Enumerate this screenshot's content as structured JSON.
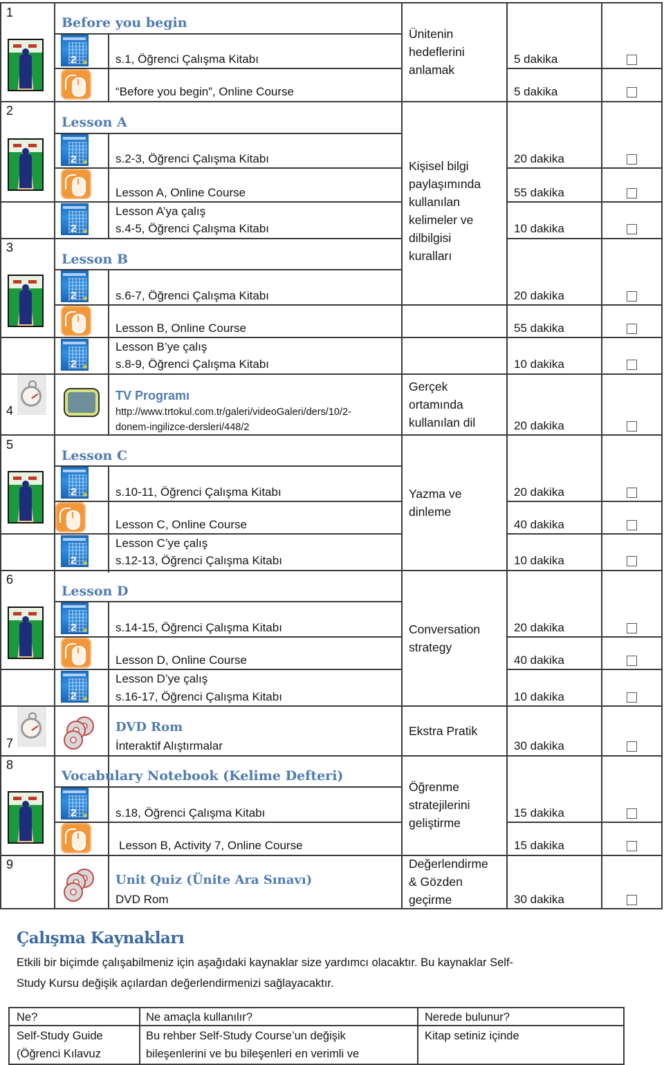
{
  "schedule": {
    "row_numbers": [
      "1",
      "2",
      "3",
      "4",
      "5",
      "6",
      "7",
      "8",
      "9"
    ],
    "section_headings": {
      "before_you_begin": "Before you begin",
      "lesson_a": "Lesson A",
      "lesson_b": "Lesson B",
      "lesson_c": "Lesson C",
      "lesson_d": "Lesson D",
      "vocabulary": "Vocabulary Notebook (Kelime Defteri)"
    },
    "items": {
      "byb_book": "s.1, Öğrenci Çalışma Kitabı",
      "byb_online": "“Before you begin”, Online Course",
      "a_book": "s.2-3, Öğrenci Çalışma Kitabı",
      "a_online": "Lesson A, Online Course",
      "a_review_1": "Lesson A’ya çalış",
      "a_review_2": "s.4-5, Öğrenci Çalışma Kitabı",
      "b_book": "s.6-7, Öğrenci Çalışma Kitabı",
      "b_online": "Lesson B, Online Course",
      "b_review_1": "Lesson B’ye çalış",
      "b_review_2": "s.8-9, Öğrenci Çalışma Kitabı",
      "tv_title": "TV Programı",
      "tv_url_1": "http://www.trtokul.com.tr/galeri/videoGaleri/ders/10/2-",
      "tv_url_2": "donem-ingilizce-dersleri/448/2",
      "c_book": "s.10-11, Öğrenci Çalışma Kitabı",
      "c_online": "Lesson C, Online Course",
      "c_review_1": "Lesson C’ye çalış",
      "c_review_2": "s.12-13, Öğrenci Çalışma Kitabı",
      "d_book": "s.14-15, Öğrenci Çalışma Kitabı",
      "d_online": "Lesson D, Online Course",
      "d_review_1": "Lesson D’ye çalış",
      "d_review_2": "s.16-17, Öğrenci Çalışma Kitabı",
      "dvd_title": "DVD Rom",
      "dvd_sub": "İnteraktif Alıştırmalar",
      "vocab_book": "s.18, Öğrenci Çalışma Kitabı",
      "vocab_online": "Lesson B, Activity 7, Online Course",
      "quiz_title": "Unit Quiz (Ünite Ara Sınavı)",
      "quiz_sub": "DVD Rom"
    },
    "goals": {
      "g1": "Ünitenin\nhedeflerini\nanlamak",
      "g2": "Kişisel bilgi\npaylaşımında\nkullanılan\nkelimeler ve\ndilbilgisi\nkuralları",
      "g3": "Gerçek\nortamında\nkullanılan dil",
      "g4": "Yazma ve\ndinleme",
      "g5": "Conversation\nstrategy",
      "g6": "Ekstra Pratik",
      "g7": "Öğrenme\nstratejilerini\ngeliştirme",
      "g8": "Değerlendirme\n& Gözden\ngeçirme"
    },
    "durations": [
      "5 dakika",
      "5 dakika",
      "20 dakika",
      "55 dakika",
      "10 dakika",
      "20 dakika",
      "55 dakika",
      "10 dakika",
      "20 dakika",
      "20 dakika",
      "40 dakika",
      "10 dakika",
      "20 dakika",
      "40 dakika",
      "10 dakika",
      "30 dakika",
      "15 dakika",
      "15 dakika",
      "30 dakika"
    ],
    "checkboxes_checked": [
      false,
      false,
      false,
      false,
      false,
      false,
      false,
      false,
      false,
      false,
      false,
      false,
      false,
      false,
      false,
      false,
      false,
      false,
      false
    ],
    "book_number": "2",
    "heading_color": "#4f7bb2"
  },
  "resources": {
    "title": "Çalışma Kaynakları",
    "intro_line_1": "Etkili bir biçimde çalışabilmeniz için aşağıdaki kaynaklar size yardımcı olacaktır. Bu kaynaklar Self-",
    "intro_line_2": "Study Kursu değişik açılardan değerlendirmenizi sağlayacaktır.",
    "table": {
      "headers": [
        "Ne?",
        "Ne amaçla kullanılır?",
        "Nerede bulunur?"
      ],
      "rows": [
        [
          "Self-Study Guide\n(Öğrenci Kılavuz",
          "Bu rehber Self-Study Course’un değişik\nbileşenlerini ve bu bileşenleri en verimli ve",
          "Kitap setiniz içinde"
        ]
      ]
    }
  }
}
